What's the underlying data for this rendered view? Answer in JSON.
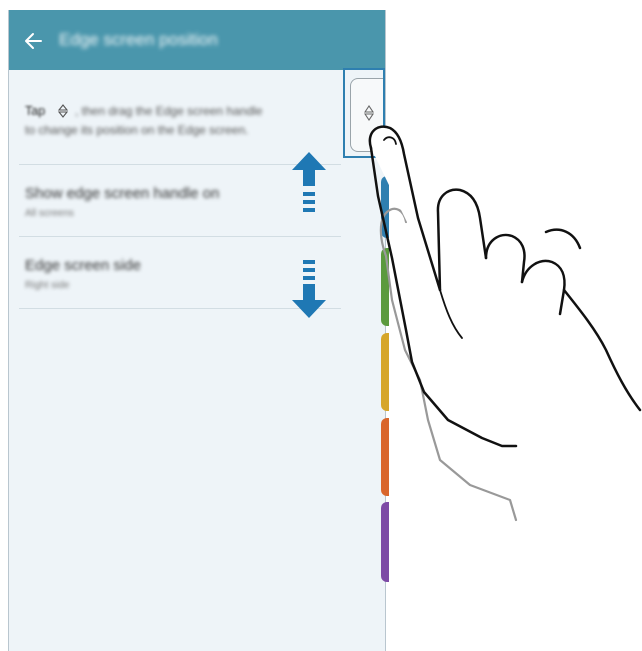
{
  "app_bar": {
    "title": "Edge screen position",
    "back_icon": "arrow-left-icon",
    "color": "#4a96ac"
  },
  "description": {
    "tap_word": "Tap",
    "inline_icon": "up-down-handle-icon",
    "line1_rest": ", then drag the Edge screen handle",
    "line2": "to change its position on the Edge screen."
  },
  "settings": [
    {
      "title": "Show edge screen handle on",
      "subtitle": "All screens"
    },
    {
      "title": "Edge screen side",
      "subtitle": "Right side"
    }
  ],
  "edge_handle": {
    "icon": "up-down-handle-icon",
    "highlight_color": "#2e7fb0"
  },
  "arrows": {
    "up_icon": "arrow-up-icon",
    "down_icon": "arrow-down-icon",
    "color": "#1f78b4"
  },
  "edge_tabs": [
    {
      "color": "#2f7fb0"
    },
    {
      "color": "#5b9a3e"
    },
    {
      "color": "#d6a62a"
    },
    {
      "color": "#d9662c"
    },
    {
      "color": "#7d4aa6"
    }
  ],
  "gesture": {
    "icon": "hand-pointer-icon"
  }
}
